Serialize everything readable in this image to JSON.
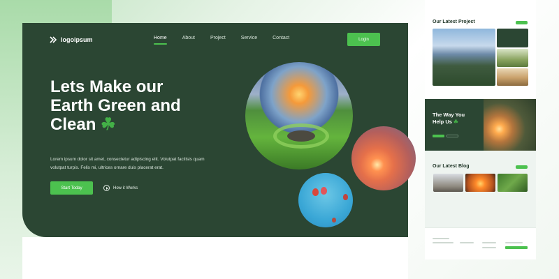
{
  "hero": {
    "logo": "logoipsum",
    "nav": [
      "Home",
      "About",
      "Project",
      "Service",
      "Contact"
    ],
    "login": "Login",
    "headline_1": "Lets Make our",
    "headline_2": "Earth Green and",
    "headline_3": "Clean",
    "clover": "☘",
    "description": "Lorem ipsum dolor sit amet, consectetur adipiscing elit. Volutpat facilisis quam volutpat turpis. Felis mi, ultrices ornare duis placerat erat.",
    "cta": "Start Today",
    "how": "How it Works"
  },
  "side": {
    "projects_title": "Our Latest Project",
    "help_title_1": "The Way You",
    "help_title_2": "Help Us",
    "blog_title": "Our Latest Blog"
  },
  "colors": {
    "brand_dark": "#2b4633",
    "accent": "#4cc14f"
  }
}
